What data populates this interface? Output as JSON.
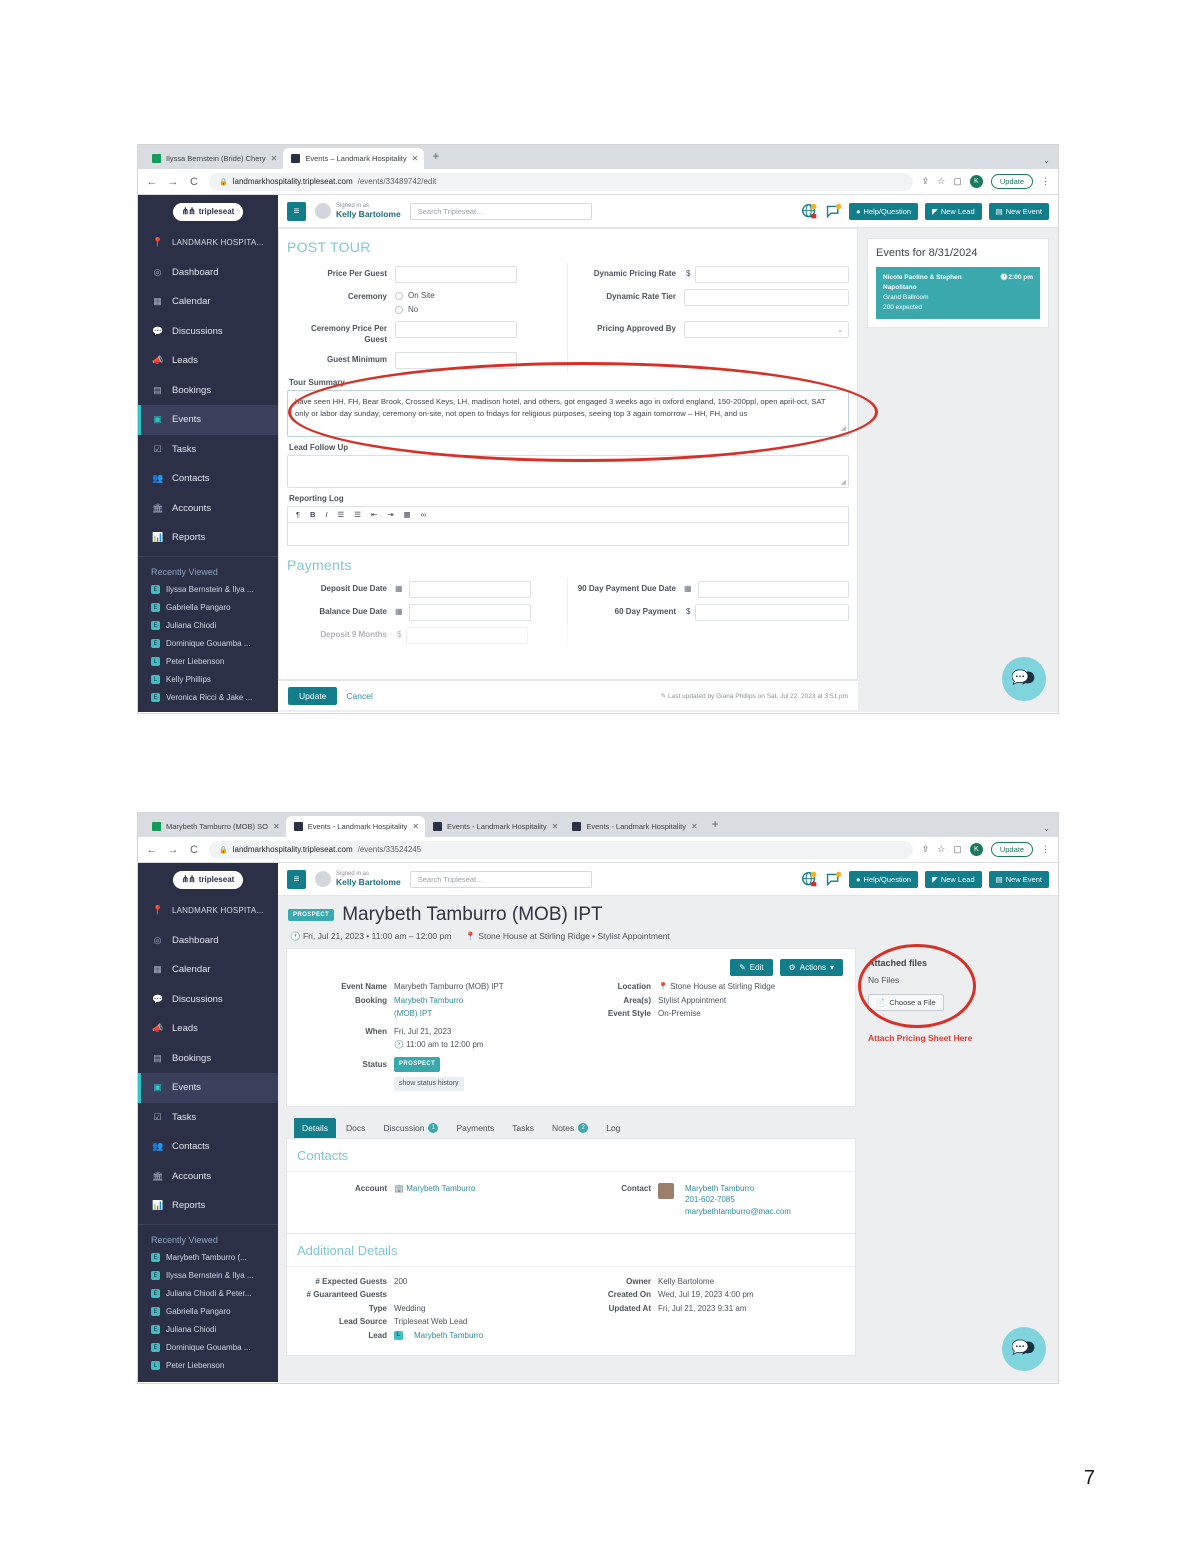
{
  "page_number": "7",
  "screenshot1": {
    "browser": {
      "tabs": [
        {
          "label": "Ilyssa Bernstein (Bride) Chery",
          "favicon": "sheets-icon",
          "active": false
        },
        {
          "label": "Events – Landmark Hospitality",
          "favicon": "tripleseat-icon",
          "active": true
        }
      ],
      "new_tab_label": "+",
      "tab_list_caret": "⌄",
      "back": "←",
      "forward": "→",
      "reload": "C",
      "lock_icon": "lock-icon",
      "url_domain": "landmarkhospitality.tripleseat.com",
      "url_path": "/events/33489742/edit",
      "share_icon": "share-icon",
      "bookmark_icon": "star-icon",
      "sidepanel_icon": "side-panel-icon",
      "profile_initial": "K",
      "update_label": "Update",
      "menu_icon": "⋮"
    },
    "app_header": {
      "menu_icon": "≡",
      "signed_in_as_label": "Signed in as",
      "user_name": "Kelly Bartolome",
      "search_placeholder": "Search Tripleseat...",
      "globe_icon": "globe-notification-icon",
      "chat_icon": "chat-notification-icon",
      "buttons": [
        {
          "label": "Help/Question",
          "icon": "question-circle-icon"
        },
        {
          "label": "New Lead",
          "icon": "megaphone-icon"
        },
        {
          "label": "New Event",
          "icon": "calendar-icon"
        }
      ]
    },
    "sidebar": {
      "brand": "tripleseat",
      "org": "LANDMARK HOSPITA...",
      "items": [
        {
          "label": "Dashboard",
          "icon": "dashboard-icon",
          "active": false
        },
        {
          "label": "Calendar",
          "icon": "calendar-icon",
          "active": false
        },
        {
          "label": "Discussions",
          "icon": "chat-icon",
          "active": false
        },
        {
          "label": "Leads",
          "icon": "megaphone-icon",
          "active": false
        },
        {
          "label": "Bookings",
          "icon": "bookmark-icon",
          "active": false
        },
        {
          "label": "Events",
          "icon": "event-icon",
          "active": true
        },
        {
          "label": "Tasks",
          "icon": "task-icon",
          "active": false
        },
        {
          "label": "Contacts",
          "icon": "contacts-icon",
          "active": false
        },
        {
          "label": "Accounts",
          "icon": "accounts-icon",
          "active": false
        },
        {
          "label": "Reports",
          "icon": "reports-icon",
          "active": false
        }
      ],
      "recently_viewed_title": "Recently Viewed",
      "recently_viewed": [
        "Ilyssa Bernstein & Ilya ...",
        "Gabriella Pangaro",
        "Juliana Chiodi",
        "Dominique Gouamba ...",
        "Peter Liebenson",
        "Kelly Phillips",
        "Veronica Ricci & Jake ..."
      ]
    },
    "form": {
      "section_title": "POST TOUR",
      "left_fields": [
        {
          "label": "Price Per Guest",
          "value": "",
          "type": "text"
        },
        {
          "label": "Ceremony",
          "type": "radio",
          "options": [
            "On Site",
            "No"
          ]
        },
        {
          "label": "Ceremony Price Per Guest",
          "value": "",
          "type": "text"
        },
        {
          "label": "Guest Minimum",
          "value": "",
          "type": "text"
        }
      ],
      "right_fields": [
        {
          "label": "Dynamic Pricing Rate",
          "value": "",
          "type": "currency",
          "prefix": "$"
        },
        {
          "label": "Dynamic Rate Tier",
          "value": "",
          "type": "text"
        },
        {
          "label": "Pricing Approved By",
          "value": "",
          "type": "select"
        }
      ],
      "tour_summary_label": "Tour Summary",
      "tour_summary_value": "have seen HH, FH, Bear Brook, Crossed Keys, LH, madison hotel, and others, got engaged 3 weeks ago in oxford england, 150-200ppl, open april-oct, SAT only or labor day sunday, ceremony on-site, not open to fridays for religious purposes, seeing top 3 again tomorrow – HH, FH, and us",
      "lead_follow_up_label": "Lead Follow Up",
      "lead_follow_up_value": "",
      "reporting_log_label": "Reporting Log",
      "reporting_log_value": "",
      "rte_buttons": [
        "¶",
        "B",
        "I",
        "list-ul-icon",
        "list-ol-icon",
        "outdent-icon",
        "indent-icon",
        "table-icon",
        "link-icon"
      ],
      "payments_title": "Payments",
      "payment_left": [
        {
          "label": "Deposit Due Date",
          "value": "",
          "type": "date"
        },
        {
          "label": "Balance Due Date",
          "value": "",
          "type": "date"
        },
        {
          "label": "Deposit  9 Months",
          "value": "",
          "type": "currency"
        }
      ],
      "payment_right": [
        {
          "label": "90 Day Payment Due Date",
          "value": "",
          "type": "date"
        },
        {
          "label": "60 Day Payment",
          "value": "",
          "type": "currency",
          "prefix": "$"
        }
      ],
      "update_label": "Update",
      "cancel_label": "Cancel",
      "last_updated": "Last updated by Giana Phillips on Sat, Jul 22, 2023 at 3:51 pm"
    },
    "rail": {
      "title": "Events for 8/31/2024",
      "events": [
        {
          "name": "Nicole Paolino & Stephen Napolitano",
          "time": "2:00 pm",
          "room": "Grand Ballroom",
          "guests": "200 expected"
        }
      ]
    },
    "chat_widget_icon": "chat-bubbles-icon",
    "annotation": "red-ellipse-around-tour-summary"
  },
  "screenshot2": {
    "browser": {
      "tabs": [
        {
          "label": "Marybeth Tamburro (MOB) SO",
          "favicon": "sheets-icon",
          "active": false
        },
        {
          "label": "Events - Landmark Hospitality",
          "favicon": "tripleseat-icon",
          "active": true
        },
        {
          "label": "Events - Landmark Hospitality",
          "favicon": "tripleseat-icon",
          "active": false
        },
        {
          "label": "Events - Landmark Hospitality",
          "favicon": "tripleseat-icon",
          "active": false
        }
      ],
      "new_tab_label": "+",
      "tab_list_caret": "⌄",
      "back": "←",
      "forward": "→",
      "reload": "C",
      "lock_icon": "lock-icon",
      "url_domain": "landmarkhospitality.tripleseat.com",
      "url_path": "/events/33524245",
      "share_icon": "share-icon",
      "bookmark_icon": "star-icon",
      "sidepanel_icon": "side-panel-icon",
      "profile_initial": "K",
      "update_label": "Update",
      "menu_icon": "⋮"
    },
    "app_header": {
      "menu_icon": "≡",
      "signed_in_as_label": "Signed in as",
      "user_name": "Kelly Bartolome",
      "search_placeholder": "Search Tripleseat...",
      "globe_icon": "globe-notification-icon",
      "chat_icon": "chat-notification-icon",
      "buttons": [
        {
          "label": "Help/Question",
          "icon": "question-circle-icon"
        },
        {
          "label": "New Lead",
          "icon": "megaphone-icon"
        },
        {
          "label": "New Event",
          "icon": "calendar-icon"
        }
      ]
    },
    "sidebar": {
      "brand": "tripleseat",
      "org": "LANDMARK HOSPITA...",
      "items": [
        {
          "label": "Dashboard",
          "icon": "dashboard-icon",
          "active": false
        },
        {
          "label": "Calendar",
          "icon": "calendar-icon",
          "active": false
        },
        {
          "label": "Discussions",
          "icon": "chat-icon",
          "active": false
        },
        {
          "label": "Leads",
          "icon": "megaphone-icon",
          "active": false
        },
        {
          "label": "Bookings",
          "icon": "bookmark-icon",
          "active": false
        },
        {
          "label": "Events",
          "icon": "event-icon",
          "active": true
        },
        {
          "label": "Tasks",
          "icon": "task-icon",
          "active": false
        },
        {
          "label": "Contacts",
          "icon": "contacts-icon",
          "active": false
        },
        {
          "label": "Accounts",
          "icon": "accounts-icon",
          "active": false
        },
        {
          "label": "Reports",
          "icon": "reports-icon",
          "active": false
        }
      ],
      "recently_viewed_title": "Recently Viewed",
      "recently_viewed": [
        "Marybeth Tamburro (...",
        "Ilyssa Bernstein & Ilya ...",
        "Juliana Chiodi & Peter...",
        "Gabriella Pangaro",
        "Juliana Chiodi",
        "Dominique Gouamba ...",
        "Peter Liebenson"
      ]
    },
    "event": {
      "status_badge": "PROSPECT",
      "title": "Marybeth Tamburro (MOB) IPT",
      "date_line": "Fri, Jul 21, 2023 • 11:00 am – 12:00 pm",
      "location_line": "Stone House at Stirling Ridge • Stylist Appointment",
      "edit_label": "Edit",
      "actions_label": "Actions",
      "left_details": [
        {
          "label": "Event Name",
          "value": "Marybeth Tamburro (MOB) IPT",
          "link": false
        },
        {
          "label": "Booking",
          "value": "Marybeth Tamburro",
          "link": true
        },
        {
          "label": "",
          "value": "(MOB) IPT",
          "link": true
        },
        {
          "label": "When",
          "value": "Fri, Jul 21, 2023",
          "link": false
        },
        {
          "label": "",
          "value": "11:00 am to 12:00 pm",
          "link": false
        }
      ],
      "status_label": "Status",
      "status_value": "PROSPECT",
      "show_status_history": "show status history",
      "right_details": [
        {
          "label": "Location",
          "value": "Stone House at Stirling Ridge",
          "icon": "pin-icon"
        },
        {
          "label": "Area(s)",
          "value": "Stylist Appointment",
          "icon": ""
        },
        {
          "label": "Event Style",
          "value": "On-Premise",
          "icon": ""
        }
      ],
      "attached_files": {
        "title": "Attached files",
        "empty_text": "No Files",
        "choose_file_label": "Choose a File",
        "annotation_text": "Attach Pricing Sheet Here"
      },
      "tabs": [
        {
          "label": "Details",
          "badge": "",
          "active": true
        },
        {
          "label": "Docs",
          "badge": "",
          "active": false
        },
        {
          "label": "Discussion",
          "badge": "1",
          "active": false
        },
        {
          "label": "Payments",
          "badge": "",
          "active": false
        },
        {
          "label": "Tasks",
          "badge": "",
          "active": false
        },
        {
          "label": "Notes",
          "badge": "2",
          "active": false
        },
        {
          "label": "Log",
          "badge": "",
          "active": false
        }
      ],
      "contacts_title": "Contacts",
      "account_label": "Account",
      "account_value": "Marybeth Tamburro",
      "contact_label": "Contact",
      "contact_name": "Marybeth Tamburro",
      "contact_phone": "201-602-7085",
      "contact_email": "marybethtamburro@mac.com",
      "additional_title": "Additional Details",
      "additional_left": [
        {
          "label": "# Expected Guests",
          "value": "200",
          "link": false
        },
        {
          "label": "# Guaranteed Guests",
          "value": "",
          "link": false
        },
        {
          "label": "Type",
          "value": "Wedding",
          "link": false
        },
        {
          "label": "Lead Source",
          "value": "Tripleseat Web Lead",
          "link": false
        },
        {
          "label": "Lead",
          "value": "Marybeth Tamburro",
          "link": true
        }
      ],
      "additional_right": [
        {
          "label": "Owner",
          "value": "Kelly Bartolome"
        },
        {
          "label": "Created On",
          "value": "Wed, Jul 19, 2023 4:00 pm"
        },
        {
          "label": "Updated At",
          "value": "Fri, Jul 21, 2023 9:31 am"
        }
      ]
    },
    "chat_widget_icon": "chat-bubbles-icon",
    "annotation": "red-ellipse-around-attached-files"
  }
}
